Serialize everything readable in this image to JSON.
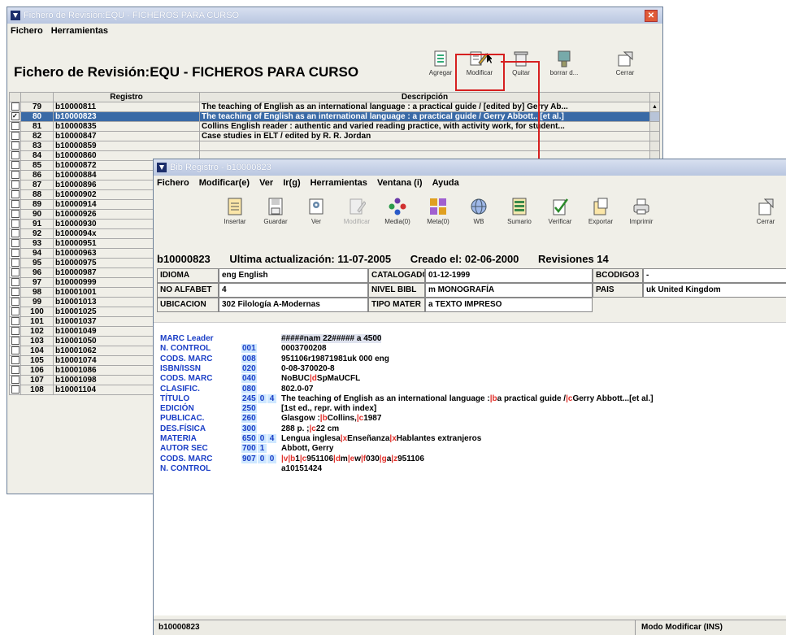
{
  "colors": {
    "selection": "#3a6aa6",
    "marc_tag": "#1a3ec6",
    "subfield": "#e0302a",
    "highlight_box": "#d62020"
  },
  "back_window": {
    "title": "Fichero de Revisión:EQU - FICHEROS PARA CURSO",
    "menu": [
      "Fichero",
      "Herramientas"
    ],
    "heading": "Fichero de Revisión:EQU - FICHEROS PARA CURSO",
    "toolbar": [
      {
        "label": "Agregar",
        "icon": "add-record-icon"
      },
      {
        "label": "Modificar",
        "icon": "modify-icon"
      },
      {
        "label": "Quitar",
        "icon": "trash-icon"
      },
      {
        "label": "borrar d...",
        "icon": "clear-icon"
      },
      {
        "label": "Cerrar",
        "icon": "close-door-icon"
      }
    ],
    "columns": {
      "registro": "Registro",
      "descripcion": "Descripción"
    },
    "rows": [
      {
        "n": "79",
        "rec": "b10000811",
        "desc": "The teaching of English as an international language : a practical guide / [edited by] Gerry Ab..."
      },
      {
        "n": "80",
        "rec": "b10000823",
        "desc": "The teaching of English as an international language : a practical guide / Gerry Abbott...[et al.]",
        "selected": true
      },
      {
        "n": "81",
        "rec": "b10000835",
        "desc": "Collins English reader : authentic and varied reading practice, with activity work, for student..."
      },
      {
        "n": "82",
        "rec": "b10000847",
        "desc": "Case studies in ELT / edited by R. R. Jordan"
      },
      {
        "n": "83",
        "rec": "b10000859",
        "desc": ""
      },
      {
        "n": "84",
        "rec": "b10000860",
        "desc": ""
      },
      {
        "n": "85",
        "rec": "b10000872",
        "desc": ""
      },
      {
        "n": "86",
        "rec": "b10000884",
        "desc": ""
      },
      {
        "n": "87",
        "rec": "b10000896",
        "desc": ""
      },
      {
        "n": "88",
        "rec": "b10000902",
        "desc": ""
      },
      {
        "n": "89",
        "rec": "b10000914",
        "desc": ""
      },
      {
        "n": "90",
        "rec": "b10000926",
        "desc": ""
      },
      {
        "n": "91",
        "rec": "b10000930",
        "desc": ""
      },
      {
        "n": "92",
        "rec": "b1000094x",
        "desc": ""
      },
      {
        "n": "93",
        "rec": "b10000951",
        "desc": ""
      },
      {
        "n": "94",
        "rec": "b10000963",
        "desc": ""
      },
      {
        "n": "95",
        "rec": "b10000975",
        "desc": ""
      },
      {
        "n": "96",
        "rec": "b10000987",
        "desc": ""
      },
      {
        "n": "97",
        "rec": "b10000999",
        "desc": ""
      },
      {
        "n": "98",
        "rec": "b10001001",
        "desc": ""
      },
      {
        "n": "99",
        "rec": "b10001013",
        "desc": ""
      },
      {
        "n": "100",
        "rec": "b10001025",
        "desc": ""
      },
      {
        "n": "101",
        "rec": "b10001037",
        "desc": ""
      },
      {
        "n": "102",
        "rec": "b10001049",
        "desc": ""
      },
      {
        "n": "103",
        "rec": "b10001050",
        "desc": ""
      },
      {
        "n": "104",
        "rec": "b10001062",
        "desc": ""
      },
      {
        "n": "105",
        "rec": "b10001074",
        "desc": ""
      },
      {
        "n": "106",
        "rec": "b10001086",
        "desc": ""
      },
      {
        "n": "107",
        "rec": "b10001098",
        "desc": ""
      },
      {
        "n": "108",
        "rec": "b10001104",
        "desc": ""
      }
    ]
  },
  "front_window": {
    "title": "Bib Registro - b10000823",
    "menu": [
      "Fichero",
      "Modificar(e)",
      "Ver",
      "Ir(g)",
      "Herramientas",
      "Ventana (i)",
      "Ayuda"
    ],
    "toolbar": [
      {
        "label": "Insertar",
        "icon": "insert-icon"
      },
      {
        "label": "Guardar",
        "icon": "save-icon"
      },
      {
        "label": "Ver",
        "icon": "view-icon"
      },
      {
        "label": "Modificar",
        "icon": "modify-icon",
        "disabled": true
      },
      {
        "label": "Media(0)",
        "icon": "media-icon"
      },
      {
        "label": "Meta(0)",
        "icon": "meta-icon"
      },
      {
        "label": "WB",
        "icon": "globe-icon"
      },
      {
        "label": "Sumario",
        "icon": "summary-icon"
      },
      {
        "label": "Verificar",
        "icon": "verify-icon"
      },
      {
        "label": "Exportar",
        "icon": "export-icon"
      },
      {
        "label": "Imprimir",
        "icon": "print-icon"
      },
      {
        "label": "Cerrar",
        "icon": "close-door-icon"
      }
    ],
    "header": {
      "record": "b10000823",
      "updated": "Ultima actualización: 11-07-2005",
      "created": "Creado el: 02-06-2000",
      "revisions": "Revisiones 14"
    },
    "fields": {
      "idioma_label": "IDIOMA",
      "idioma_value": "eng  English",
      "catalogado_label": "CATALOGADO",
      "catalogado_value": "01-12-1999",
      "bcodigo_label": "BCODIGO3",
      "bcodigo_value": "-",
      "noalfabet_label": "NO ALFABET",
      "noalfabet_value": "4",
      "nivel_label": "NIVEL BIBL",
      "nivel_value": "m  MONOGRAFÍA",
      "pais_label": "PAIS",
      "pais_value": "uk   United Kingdom",
      "ubicacion_label": "UBICACION",
      "ubicacion_value": "302    Filología A-Modernas",
      "tipo_label": "TIPO MATER",
      "tipo_value": "a  TEXTO IMPRESO"
    },
    "marc": [
      {
        "tag": "MARC Leader",
        "num": "",
        "i1": "",
        "i2": "",
        "value": "#####nam  22##### a 4500"
      },
      {
        "tag": "N. CONTROL",
        "num": "001",
        "i1": "",
        "i2": "",
        "value": "0003700208"
      },
      {
        "tag": "CODS. MARC",
        "num": "008",
        "i1": "",
        "i2": "",
        "value": "951106r19871981uk          000  eng"
      },
      {
        "tag": "ISBN/ISSN",
        "num": "020",
        "i1": "",
        "i2": "",
        "value": "0-08-370020-8"
      },
      {
        "tag": "CODS. MARC",
        "num": "040",
        "i1": "",
        "i2": "",
        "value": "NoBUC|dSpMaUCFL"
      },
      {
        "tag": "CLASIFIC.",
        "num": "080",
        "i1": "",
        "i2": "",
        "value": "802.0-07"
      },
      {
        "tag": "TÍTULO",
        "num": "245",
        "i1": "0",
        "i2": "4",
        "value": "The teaching of English as an international language :|ba practical guide /|cGerry Abbott...[et al.]"
      },
      {
        "tag": "EDICIÓN",
        "num": "250",
        "i1": "",
        "i2": "",
        "value": "[1st ed., repr. with index]"
      },
      {
        "tag": "PUBLICAC.",
        "num": "260",
        "i1": "",
        "i2": "",
        "value": "Glasgow :|bCollins,|c1987"
      },
      {
        "tag": "DES.FÍSICA",
        "num": "300",
        "i1": "",
        "i2": "",
        "value": "288 p. ;|c22 cm"
      },
      {
        "tag": "MATERIA",
        "num": "650",
        "i1": "0",
        "i2": "4",
        "value": "Lengua inglesa|xEnseñanza|xHablantes extranjeros"
      },
      {
        "tag": "AUTOR SEC",
        "num": "700",
        "i1": "1",
        "i2": "",
        "value": "Abbott, Gerry"
      },
      {
        "tag": "CODS. MARC",
        "num": "907",
        "i1": "0",
        "i2": "0",
        "value": "|v|b1|c951106|dm|ew|f030|ga|z951106"
      },
      {
        "tag": "N. CONTROL",
        "num": "",
        "i1": "",
        "i2": "",
        "value": "a10151424"
      }
    ],
    "status": {
      "left": "b10000823",
      "right": "Modo Modificar (INS)"
    }
  }
}
